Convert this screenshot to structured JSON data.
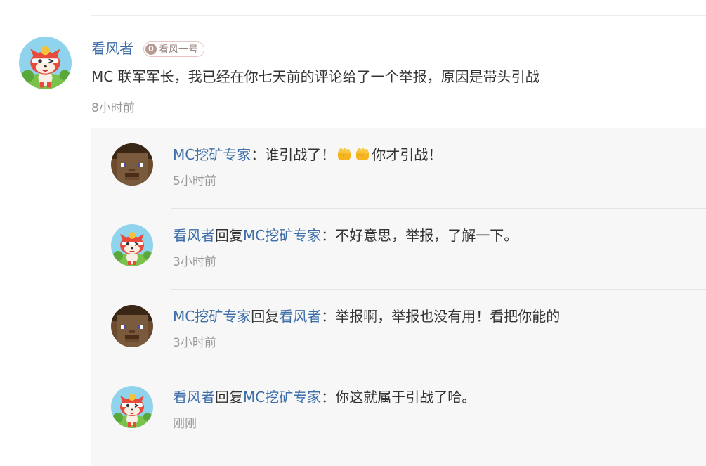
{
  "comment": {
    "author": "看风者",
    "badge_text": "看风一号",
    "badge_icon": "level-0-coin-icon",
    "badge_level": "0",
    "text": "MC 联军军长，我已经在你七天前的评论给了一个举报，原因是带头引战",
    "time": "8小时前"
  },
  "replies": [
    {
      "author": "MC挖矿专家",
      "reply_word": "",
      "target": "",
      "colon": "：",
      "text_before": "谁引战了！",
      "emoji": "fist-emoji ×2",
      "text_after": "你才引战！",
      "time": "5小时前"
    },
    {
      "author": "看风者",
      "reply_word": "回复",
      "target": "MC挖矿专家",
      "colon": "：",
      "text": "不好意思，举报，了解一下。",
      "time": "3小时前"
    },
    {
      "author": "MC挖矿专家",
      "reply_word": "回复",
      "target": "看风者",
      "colon": "：",
      "text": "举报啊，举报也没有用！看把你能的",
      "time": "3小时前"
    },
    {
      "author": "看风者",
      "reply_word": "回复",
      "target": "MC挖矿专家",
      "colon": "：",
      "text": "你这就属于引战了哈。",
      "time": "刚刚"
    }
  ],
  "colors": {
    "link": "#3d6ea8",
    "text": "#333333",
    "meta": "#999999",
    "reply_bg": "#f7f7f7"
  }
}
